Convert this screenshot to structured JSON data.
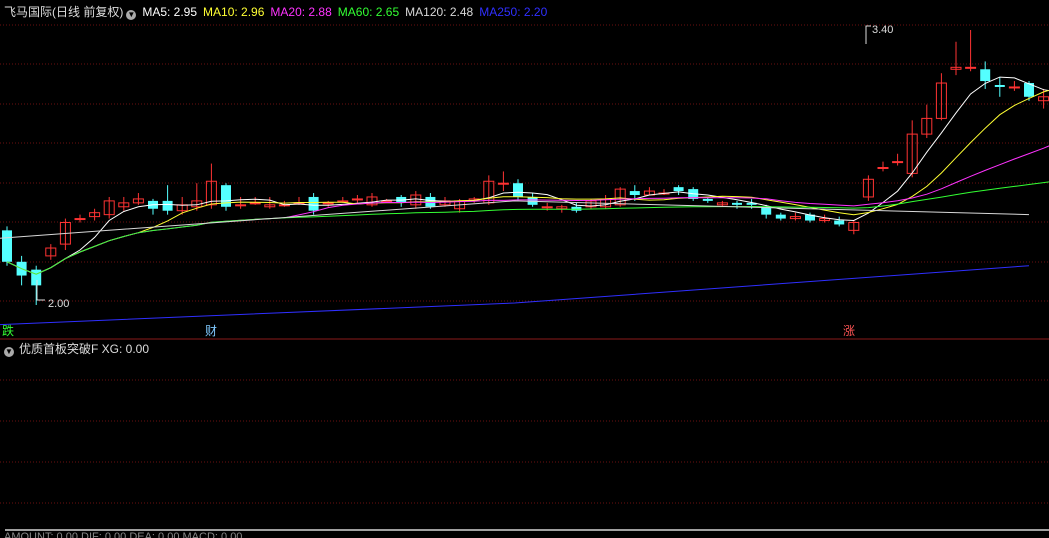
{
  "header": {
    "title": "飞马国际(日线 前复权)",
    "ma": [
      {
        "label": "MA5: 2.95",
        "color": "#ffffff"
      },
      {
        "label": "MA10: 2.96",
        "color": "#ffff33"
      },
      {
        "label": "MA20: 2.88",
        "color": "#ff33ff"
      },
      {
        "label": "MA60: 2.65",
        "color": "#33ff33"
      },
      {
        "label": "MA120: 2.48",
        "color": "#d8d8d8"
      },
      {
        "label": "MA250: 2.20",
        "color": "#2f2fff"
      }
    ]
  },
  "price_labels": {
    "high": "3.40",
    "low": "2.00"
  },
  "badges": [
    {
      "text": "跌",
      "color": "#33ff33"
    },
    {
      "text": "财",
      "color": "#7fc9ff"
    },
    {
      "text": "涨",
      "color": "#ff5555"
    }
  ],
  "indicator": {
    "label": "优质首板突破F  XG: 0.00"
  },
  "bottom_text": "AMOUNT: 0.00  DIF: 0.00  DEA: 0.00  MACD: 0.00",
  "colors": {
    "up": "#ff3333",
    "down": "#54ffff",
    "grid": "#6b1010",
    "signal": "#ffffff"
  },
  "chart_data": {
    "type": "candlestick",
    "y_range": [
      1.9,
      3.5
    ],
    "candles": [
      [
        2.38,
        2.22,
        2.4,
        2.2
      ],
      [
        2.22,
        2.15,
        2.25,
        2.1
      ],
      [
        2.18,
        2.1,
        2.2,
        2.0
      ],
      [
        2.25,
        2.29,
        2.31,
        2.23
      ],
      [
        2.31,
        2.42,
        2.44,
        2.28
      ],
      [
        2.44,
        2.44,
        2.46,
        2.42
      ],
      [
        2.45,
        2.47,
        2.49,
        2.43
      ],
      [
        2.46,
        2.53,
        2.55,
        2.44
      ],
      [
        2.5,
        2.52,
        2.55,
        2.48
      ],
      [
        2.52,
        2.54,
        2.57,
        2.51
      ],
      [
        2.53,
        2.49,
        2.54,
        2.46
      ],
      [
        2.53,
        2.48,
        2.61,
        2.46
      ],
      [
        2.48,
        2.51,
        2.55,
        2.46
      ],
      [
        2.5,
        2.53,
        2.62,
        2.48
      ],
      [
        2.51,
        2.63,
        2.72,
        2.49
      ],
      [
        2.61,
        2.5,
        2.62,
        2.48
      ],
      [
        2.51,
        2.51,
        2.55,
        2.49
      ],
      [
        2.52,
        2.52,
        2.55,
        2.51
      ],
      [
        2.5,
        2.51,
        2.55,
        2.49
      ],
      [
        2.51,
        2.51,
        2.53,
        2.5
      ],
      [
        2.52,
        2.52,
        2.55,
        2.51
      ],
      [
        2.55,
        2.48,
        2.57,
        2.46
      ],
      [
        2.52,
        2.52,
        2.53,
        2.5
      ],
      [
        2.53,
        2.53,
        2.55,
        2.52
      ],
      [
        2.54,
        2.54,
        2.56,
        2.52
      ],
      [
        2.51,
        2.55,
        2.57,
        2.5
      ],
      [
        2.53,
        2.53,
        2.54,
        2.52
      ],
      [
        2.55,
        2.52,
        2.56,
        2.5
      ],
      [
        2.51,
        2.56,
        2.58,
        2.49
      ],
      [
        2.55,
        2.5,
        2.57,
        2.49
      ],
      [
        2.51,
        2.53,
        2.55,
        2.5
      ],
      [
        2.49,
        2.53,
        2.54,
        2.47
      ],
      [
        2.53,
        2.54,
        2.55,
        2.52
      ],
      [
        2.52,
        2.63,
        2.66,
        2.51
      ],
      [
        2.62,
        2.62,
        2.68,
        2.58
      ],
      [
        2.62,
        2.55,
        2.64,
        2.53
      ],
      [
        2.55,
        2.51,
        2.57,
        2.5
      ],
      [
        2.5,
        2.5,
        2.52,
        2.48
      ],
      [
        2.49,
        2.5,
        2.51,
        2.47
      ],
      [
        2.5,
        2.48,
        2.52,
        2.47
      ],
      [
        2.5,
        2.53,
        2.54,
        2.49
      ],
      [
        2.5,
        2.54,
        2.56,
        2.49
      ],
      [
        2.51,
        2.59,
        2.6,
        2.5
      ],
      [
        2.58,
        2.56,
        2.61,
        2.53
      ],
      [
        2.56,
        2.58,
        2.6,
        2.56
      ],
      [
        2.57,
        2.57,
        2.59,
        2.56
      ],
      [
        2.6,
        2.58,
        2.61,
        2.56
      ],
      [
        2.59,
        2.54,
        2.6,
        2.53
      ],
      [
        2.54,
        2.53,
        2.55,
        2.52
      ],
      [
        2.51,
        2.52,
        2.53,
        2.5
      ],
      [
        2.52,
        2.51,
        2.53,
        2.49
      ],
      [
        2.52,
        2.51,
        2.54,
        2.49
      ],
      [
        2.5,
        2.46,
        2.51,
        2.44
      ],
      [
        2.46,
        2.44,
        2.47,
        2.43
      ],
      [
        2.44,
        2.45,
        2.47,
        2.43
      ],
      [
        2.46,
        2.43,
        2.47,
        2.42
      ],
      [
        2.43,
        2.44,
        2.46,
        2.42
      ],
      [
        2.43,
        2.41,
        2.45,
        2.4
      ],
      [
        2.38,
        2.42,
        2.43,
        2.36
      ],
      [
        2.55,
        2.64,
        2.66,
        2.53
      ],
      [
        2.7,
        2.7,
        2.73,
        2.68
      ],
      [
        2.73,
        2.73,
        2.77,
        2.71
      ],
      [
        2.67,
        2.87,
        2.94,
        2.65
      ],
      [
        2.87,
        2.95,
        3.02,
        2.85
      ],
      [
        2.95,
        3.13,
        3.18,
        2.94
      ],
      [
        3.2,
        3.21,
        3.34,
        3.17
      ],
      [
        3.21,
        3.21,
        3.4,
        3.19
      ],
      [
        3.2,
        3.14,
        3.24,
        3.1
      ],
      [
        3.12,
        3.11,
        3.16,
        3.06
      ],
      [
        3.11,
        3.11,
        3.14,
        3.09
      ],
      [
        3.13,
        3.06,
        3.14,
        3.04
      ],
      [
        3.04,
        3.06,
        3.1,
        3.0
      ],
      [
        3.06,
        3.08,
        3.09,
        3.03
      ],
      [
        3.09,
        3.12,
        3.14,
        3.07
      ],
      [
        3.11,
        3.11,
        3.14,
        3.09
      ],
      [
        3.12,
        3.05,
        3.13,
        3.03
      ],
      [
        3.03,
        3.03,
        3.06,
        3.01
      ]
    ],
    "ma_series": [
      {
        "name": "MA5",
        "color": "#ffffff"
      },
      {
        "name": "MA10",
        "color": "#ffff33"
      },
      {
        "name": "MA20",
        "color": "#ff33ff"
      },
      {
        "name": "MA60",
        "color": "#33ff33"
      },
      {
        "name": "MA120",
        "color": "#d8d8d8",
        "values": [
          2.34,
          2.53,
          2.46
        ]
      },
      {
        "name": "MA250",
        "color": "#2f2fff",
        "values": [
          1.9,
          2.01,
          2.2
        ]
      }
    ],
    "xg_signal": {
      "index": 60,
      "value": 1,
      "baseline": 0
    }
  }
}
